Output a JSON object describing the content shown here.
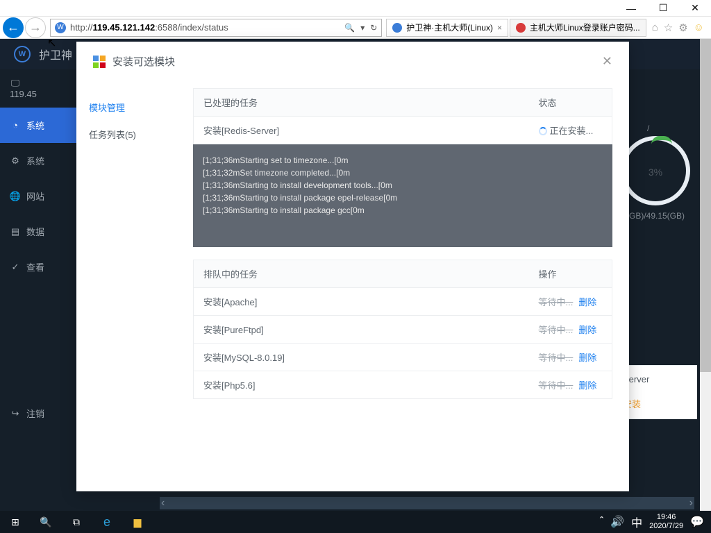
{
  "window": {
    "url_prefix": "http://",
    "url_host": "119.45.121.142",
    "url_suffix": ":6588/index/status"
  },
  "tabs": [
    {
      "title": "护卫神·主机大师(Linux)"
    },
    {
      "title": "主机大师Linux登录账户密码..."
    }
  ],
  "app": {
    "brand": "护卫神",
    "ip": "119.45",
    "menu": {
      "system": "系统",
      "system2": "系统",
      "web": "网站",
      "data": "数据",
      "check": "查看",
      "logout": "注销"
    }
  },
  "gauge": {
    "percent": "3%",
    "disk": "(GB)/49.15(GB)",
    "slash": "/"
  },
  "service": {
    "name": "Server",
    "action": "安装"
  },
  "modal": {
    "title": "安装可选模块",
    "nav": {
      "module_mgmt": "模块管理",
      "task_list": "任务列表(5)"
    },
    "processed": {
      "header_task": "已处理的任务",
      "header_status": "状态",
      "row_task": "安装[Redis-Server]",
      "row_status": "正在安装..."
    },
    "console_lines": [
      "[1;31;36mStarting set to timezone...[0m",
      "[1;31;32mSet timezone completed...[0m",
      "[1;31;36mStarting to install development tools...[0m",
      "[1;31;36mStarting to install package epel-release[0m",
      "[1;31;36mStarting to install package gcc[0m"
    ],
    "queue": {
      "header_task": "排队中的任务",
      "header_op": "操作",
      "waiting": "等待中...",
      "delete": "删除",
      "items": [
        "安装[Apache]",
        "安装[PureFtpd]",
        "安装[MySQL-8.0.19]",
        "安装[Php5.6]"
      ]
    }
  },
  "taskbar": {
    "time": "19:46",
    "date": "2020/7/29",
    "ime": "中"
  }
}
